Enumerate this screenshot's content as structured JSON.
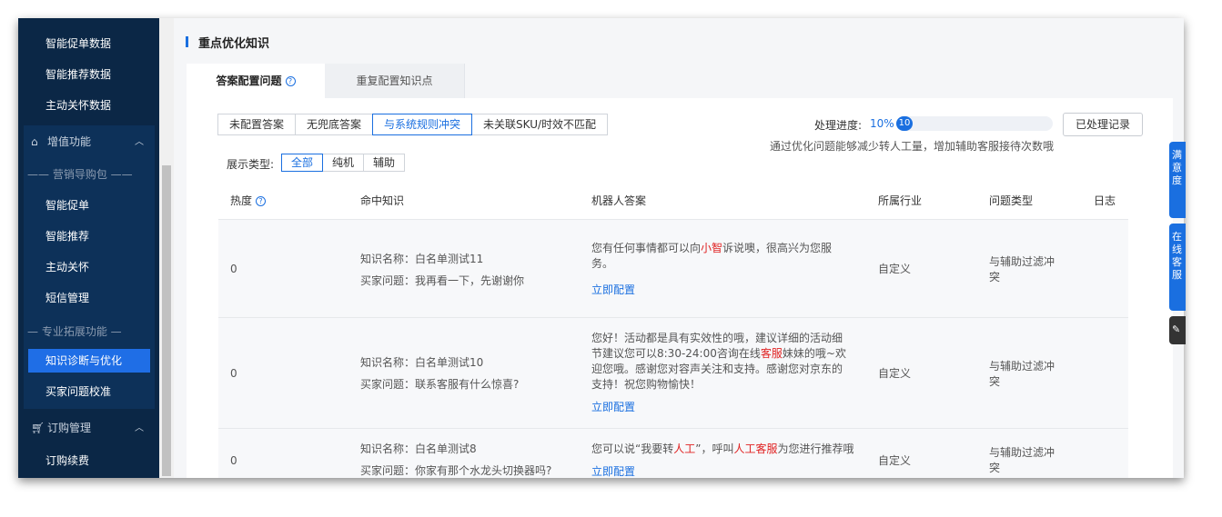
{
  "sidebar": {
    "top_items": [
      "智能促单数据",
      "智能推荐数据",
      "主动关怀数据"
    ],
    "group_value_added": {
      "label": "增值功能",
      "icon": "gift-icon",
      "chevron": "chevron-up-icon"
    },
    "divider_marketing": "—— 营销导购包 ——",
    "marketing_items": [
      "智能促单",
      "智能推荐",
      "主动关怀",
      "短信管理"
    ],
    "divider_extension": "— 专业拓展功能 —",
    "extension_items": [
      "知识诊断与优化",
      "买家问题校准"
    ],
    "active_item": "知识诊断与优化",
    "group_order": {
      "label": "订购管理",
      "icon": "cart-icon",
      "chevron": "chevron-up-icon"
    },
    "order_items": [
      "订购续费"
    ]
  },
  "main": {
    "section_title": "重点优化知识",
    "tabs": [
      {
        "label": "答案配置问题",
        "active": true
      },
      {
        "label": "重复配置知识点",
        "active": false
      }
    ],
    "filters": [
      "未配置答案",
      "无兜底答案",
      "与系统规则冲突",
      "未关联SKU/时效不匹配"
    ],
    "active_filter": "与系统规则冲突",
    "display_type_label": "展示类型:",
    "display_types": [
      "全部",
      "纯机",
      "辅助"
    ],
    "active_display_type": "全部",
    "progress": {
      "label": "处理进度:",
      "percent_text": "10%",
      "count": "10",
      "fraction": 0.1
    },
    "hint": "通过优化问题能够减少转人工量，增加辅助客服接待次数哦",
    "record_button": "已处理记录",
    "columns": [
      "热度",
      "命中知识",
      "机器人答案",
      "所属行业",
      "问题类型",
      "日志"
    ],
    "rows": [
      {
        "heat": "0",
        "knowledge_name": "知识名称：白名单测试11",
        "buyer_question": "买家问题：我再看一下，先谢谢你",
        "answer_parts": [
          "您有任何事情都可以向",
          "小智",
          "诉说噢，很高兴为您服务。"
        ],
        "answer_link": "立即配置",
        "industry": "自定义",
        "type": "与辅助过滤冲突"
      },
      {
        "heat": "0",
        "knowledge_name": "知识名称：白名单测试10",
        "buyer_question": "买家问题：联系客服有什么惊喜?",
        "answer_parts": [
          "您好！活动都是具有实效性的哦，建议详细的活动细节建议您可以8:30-24:00咨询在线",
          "客服",
          "妹妹的哦~欢迎您哦。感谢您对容声关注和支持。感谢您对京东的支持！祝您购物愉快！"
        ],
        "answer_link": "立即配置",
        "industry": "自定义",
        "type": "与辅助过滤冲突"
      },
      {
        "heat": "0",
        "knowledge_name": "知识名称：白名单测试8",
        "buyer_question": "买家问题：你家有那个水龙头切换器吗?",
        "answer_parts": [
          "您可以说“我要转",
          "人工",
          "”，呼叫",
          "人工客服",
          "为您进行推荐哦"
        ],
        "answer_link": "立即配置",
        "industry": "自定义",
        "type": "与辅助过滤冲突"
      }
    ]
  },
  "float_tabs": [
    "满意度",
    "在线客服"
  ],
  "colors": {
    "sidebar_bg": "#0b2746",
    "accent": "#1a6fe0",
    "highlight": "#e02020"
  }
}
